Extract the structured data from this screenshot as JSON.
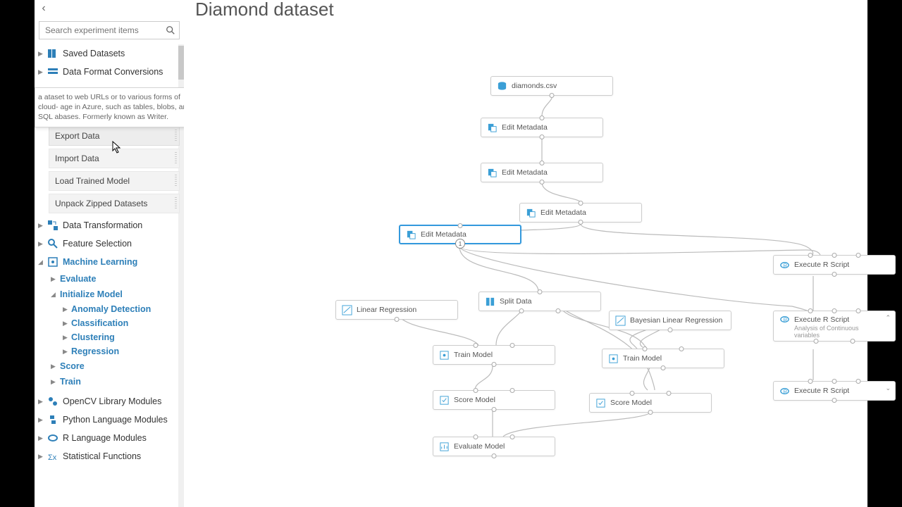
{
  "title": "Diamond dataset",
  "search": {
    "placeholder": "Search experiment items"
  },
  "tooltip": "a\nataset to web URLs or to various forms of cloud-\nage in Azure, such as tables, blobs, and SQL\nabases. Formerly known as Writer.",
  "sidebar": {
    "cats_top": [
      {
        "label": "Saved Datasets"
      },
      {
        "label": "Data Format Conversions"
      }
    ],
    "modules": [
      {
        "label": "Export Data"
      },
      {
        "label": "Import Data"
      },
      {
        "label": "Load Trained Model"
      },
      {
        "label": "Unpack Zipped Datasets"
      }
    ],
    "cats_mid": [
      {
        "label": "Data Transformation"
      },
      {
        "label": "Feature Selection"
      }
    ],
    "ml": {
      "label": "Machine Learning",
      "children": [
        {
          "label": "Evaluate"
        },
        {
          "label": "Initialize Model",
          "children": [
            {
              "label": "Anomaly Detection"
            },
            {
              "label": "Classification"
            },
            {
              "label": "Clustering"
            },
            {
              "label": "Regression"
            }
          ]
        },
        {
          "label": "Score"
        },
        {
          "label": "Train"
        }
      ]
    },
    "cats_bot": [
      {
        "label": "OpenCV Library Modules"
      },
      {
        "label": "Python Language Modules"
      },
      {
        "label": "R Language Modules"
      },
      {
        "label": "Statistical Functions"
      }
    ]
  },
  "nodes": {
    "n0": "diamonds.csv",
    "n1": "Edit Metadata",
    "n2": "Edit Metadata",
    "n3": "Edit Metadata",
    "n4": "Edit Metadata",
    "n5": "Split Data",
    "n6": "Linear Regression",
    "n7": "Bayesian Linear Regression",
    "n8": "Execute R Script",
    "n9": "Execute R Script",
    "n9sub": "Analysis of Continuous variables",
    "n10": "Execute R Script",
    "n11": "Train Model",
    "n12": "Train Model",
    "n13": "Score Model",
    "n14": "Score Model",
    "n15": "Evaluate Model",
    "badge1": "1"
  }
}
